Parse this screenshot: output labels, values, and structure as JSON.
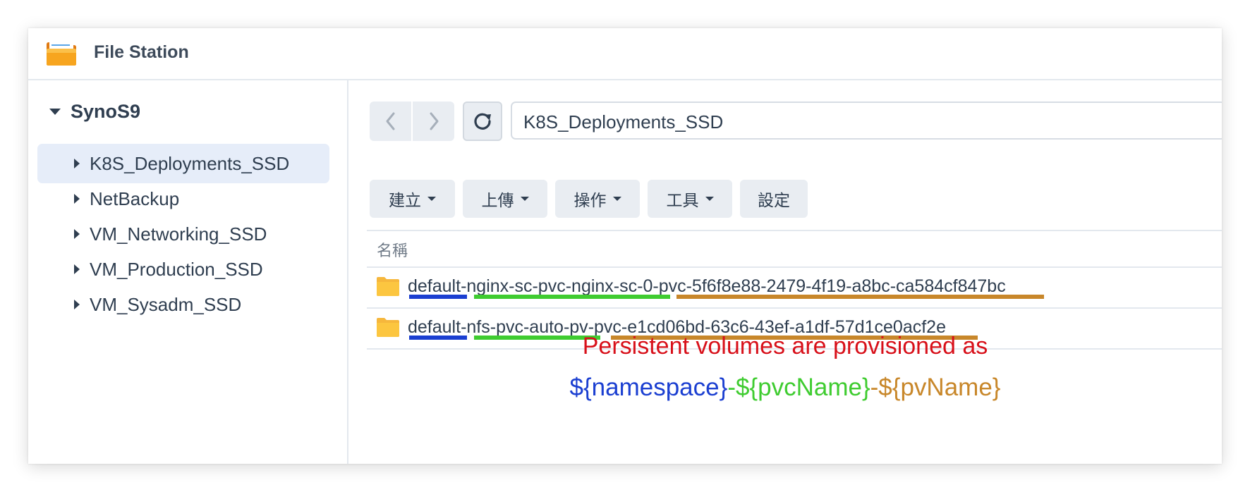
{
  "app": {
    "title": "File Station"
  },
  "sidebar": {
    "root": "SynoS9",
    "items": [
      {
        "label": "K8S_Deployments_SSD",
        "selected": true
      },
      {
        "label": "NetBackup",
        "selected": false
      },
      {
        "label": "VM_Networking_SSD",
        "selected": false
      },
      {
        "label": "VM_Production_SSD",
        "selected": false
      },
      {
        "label": "VM_Sysadm_SSD",
        "selected": false
      }
    ]
  },
  "navigation": {
    "back_icon": "chevron-left-icon",
    "forward_icon": "chevron-right-icon",
    "refresh_icon": "refresh-icon",
    "path": "K8S_Deployments_SSD"
  },
  "toolbar": {
    "create": "建立",
    "upload": "上傳",
    "action": "操作",
    "tools": "工具",
    "settings": "設定"
  },
  "file_list": {
    "column_name": "名稱",
    "rows": [
      {
        "name": "default-nginx-sc-pvc-nginx-sc-0-pvc-5f6f8e88-2479-4f19-a8bc-ca584cf847bc",
        "icon": "folder-icon",
        "segments": {
          "namespace": "default",
          "sep1": "-",
          "pvc": "nginx-sc-pvc-nginx-sc-0",
          "sep2": "-",
          "pv": "pvc-5f6f8e88-2479-4f19-a8bc-ca584cf847bc"
        }
      },
      {
        "name": "default-nfs-pvc-auto-pv-pvc-e1cd06bd-63c6-43ef-a1df-57d1ce0acf2e",
        "icon": "folder-icon",
        "segments": {
          "namespace": "default",
          "sep1": "-",
          "pvc": "nfs-pvc-auto-pv",
          "sep2": "-",
          "pv": "pvc-e1cd06bd-63c6-43ef-a1df-57d1ce0acf2e"
        }
      }
    ]
  },
  "annotation": {
    "line1": "Persistent volumes are provisioned as",
    "line2": {
      "namespace": "${namespace}",
      "sep1": "-",
      "pvc": "${pvcName}",
      "sep2": "-",
      "pv": "${pvName}"
    }
  },
  "colors": {
    "namespace": "#1b3fd1",
    "pvc": "#3fcc30",
    "pv": "#c8872a",
    "annotation_title": "#d8101a",
    "selected_bg": "#e6edf9",
    "text": "#2f3e50"
  }
}
